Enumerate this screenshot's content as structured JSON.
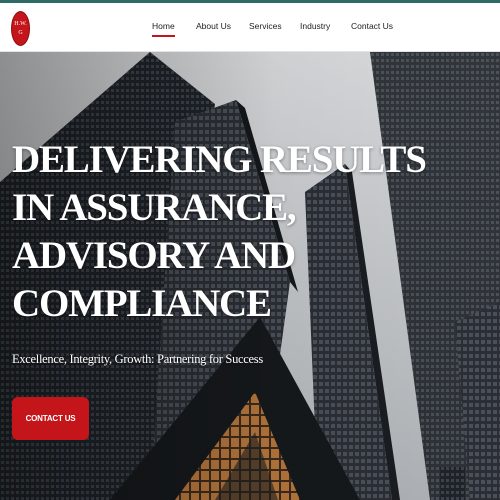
{
  "logo": {
    "line1": "H.W.",
    "line2": "G"
  },
  "nav": {
    "items": [
      {
        "label": "Home",
        "active": true
      },
      {
        "label": "About Us",
        "active": false
      },
      {
        "label": "Services",
        "active": false
      },
      {
        "label": "Industry",
        "active": false
      },
      {
        "label": "Contact Us",
        "active": false
      }
    ]
  },
  "hero": {
    "headline": [
      "DELIVERING RESULTS",
      "IN ASSURANCE,",
      "ADVISORY AND",
      "COMPLIANCE"
    ],
    "tagline": "Excellence, Integrity, Growth: Partnering for Success",
    "cta_label": "CONTACT US"
  },
  "colors": {
    "accent": "#c4151a",
    "topline": "#2e6b66"
  }
}
